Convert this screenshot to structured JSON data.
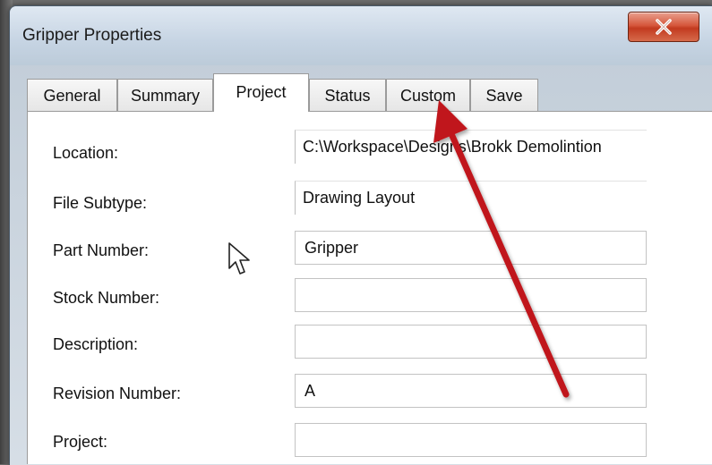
{
  "window": {
    "title": "Gripper Properties"
  },
  "tabs": [
    {
      "label": "General"
    },
    {
      "label": "Summary"
    },
    {
      "label": "Project"
    },
    {
      "label": "Status"
    },
    {
      "label": "Custom"
    },
    {
      "label": "Save"
    }
  ],
  "fields": [
    {
      "label": "Location:",
      "value": "C:\\Workspace\\Designs\\Brokk Demolintion"
    },
    {
      "label": "File Subtype:",
      "value": "Drawing Layout"
    },
    {
      "label": "Part Number:",
      "value": "Gripper"
    },
    {
      "label": "Stock Number:",
      "value": ""
    },
    {
      "label": "Description:",
      "value": ""
    },
    {
      "label": "Revision Number:",
      "value": "A"
    },
    {
      "label": "Project:",
      "value": ""
    }
  ],
  "colors": {
    "annotation_arrow": "#c0171b",
    "close_button": "#c9452a"
  },
  "icons": {
    "close": "close-icon",
    "pointer": "mouse-pointer-icon",
    "annotation": "red-arrow-annotation"
  }
}
